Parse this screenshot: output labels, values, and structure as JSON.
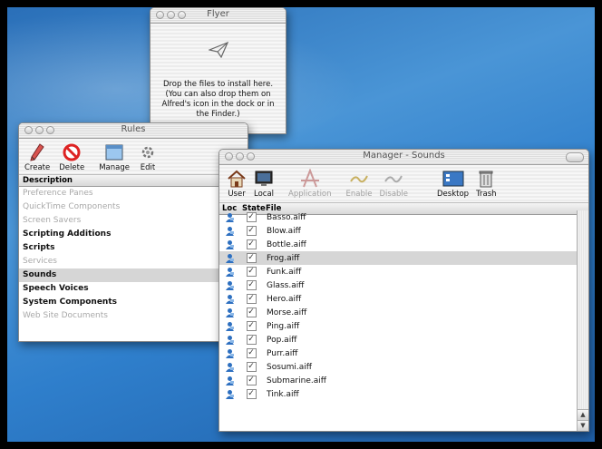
{
  "flyer": {
    "title": "Flyer",
    "message_lines": [
      "Drop the files to install here.",
      "(You can also drop them on",
      "Alfred's icon in the dock or in",
      "the Finder.)"
    ]
  },
  "rules": {
    "title": "Rules",
    "toolbar": {
      "create": "Create",
      "delete": "Delete",
      "manage": "Manage",
      "edit": "Edit"
    },
    "column_header": "Description",
    "items": [
      {
        "label": "Preference Panes",
        "enabled": false
      },
      {
        "label": "QuickTime Components",
        "enabled": false
      },
      {
        "label": "Screen Savers",
        "enabled": false
      },
      {
        "label": "Scripting Additions",
        "enabled": true
      },
      {
        "label": "Scripts",
        "enabled": true
      },
      {
        "label": "Services",
        "enabled": false
      },
      {
        "label": "Sounds",
        "enabled": true,
        "selected": true
      },
      {
        "label": "Speech Voices",
        "enabled": true
      },
      {
        "label": "System Components",
        "enabled": true
      },
      {
        "label": "Web Site Documents",
        "enabled": false
      }
    ]
  },
  "manager": {
    "title": "Manager - Sounds",
    "toolbar": {
      "user": "User",
      "local": "Local",
      "application": "Application",
      "enable": "Enable",
      "disable": "Disable",
      "desktop": "Desktop",
      "trash": "Trash"
    },
    "columns": {
      "loc": "Loc",
      "state": "State",
      "file": "File"
    },
    "files": [
      "Basso.aiff",
      "Blow.aiff",
      "Bottle.aiff",
      "Frog.aiff",
      "Funk.aiff",
      "Glass.aiff",
      "Hero.aiff",
      "Morse.aiff",
      "Ping.aiff",
      "Pop.aiff",
      "Purr.aiff",
      "Sosumi.aiff",
      "Submarine.aiff",
      "Tink.aiff"
    ],
    "selected_file": "Frog.aiff"
  }
}
